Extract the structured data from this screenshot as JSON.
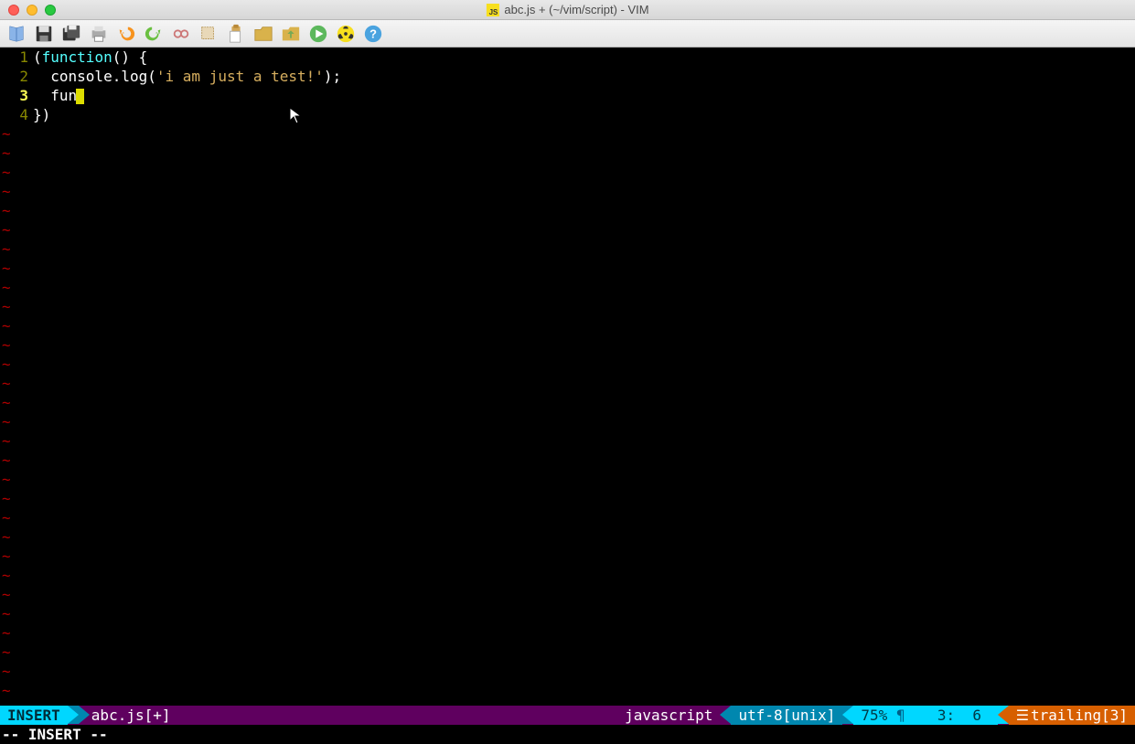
{
  "window": {
    "title": "abc.js + (~/vim/script) - VIM"
  },
  "toolbar": {
    "items": [
      "open",
      "save",
      "save-all",
      "print",
      "undo",
      "redo",
      "glasses",
      "cut",
      "copy",
      "paste",
      "folder",
      "tile",
      "play",
      "radiation",
      "help"
    ]
  },
  "editor": {
    "lines": [
      {
        "num": "1",
        "segments": [
          {
            "t": "(",
            "c": "tok-paren"
          },
          {
            "t": "function",
            "c": "tok-keyword"
          },
          {
            "t": "() {",
            "c": "tok-paren"
          }
        ]
      },
      {
        "num": "2",
        "segments": [
          {
            "t": "  console",
            "c": "tok-ident"
          },
          {
            "t": ".",
            "c": "tok-punc"
          },
          {
            "t": "log",
            "c": "tok-method"
          },
          {
            "t": "(",
            "c": "tok-paren"
          },
          {
            "t": "'i am just a test!'",
            "c": "tok-string"
          },
          {
            "t": ");",
            "c": "tok-punc"
          }
        ]
      },
      {
        "num": "3",
        "current": true,
        "segments": [
          {
            "t": "  fun",
            "c": "tok-ident"
          }
        ],
        "cursor": true
      },
      {
        "num": "4",
        "segments": [
          {
            "t": "})",
            "c": "tok-paren"
          }
        ]
      }
    ],
    "tilde": "~"
  },
  "statusline": {
    "mode": "INSERT",
    "filename": "abc.js[+]",
    "filetype": "javascript",
    "encoding": "utf-8[unix]",
    "percent": "75%",
    "pilcrow": "¶",
    "line": "3",
    "col": "6",
    "trailing_label": "trailing[3]",
    "xi": "☰"
  },
  "cmdline": {
    "text": "-- INSERT --"
  }
}
